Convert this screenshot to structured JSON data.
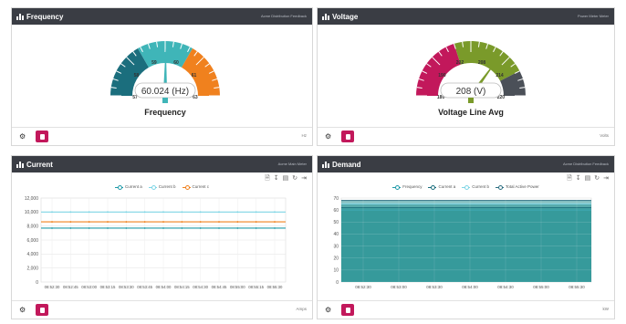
{
  "frequency_panel": {
    "title": "Frequency",
    "subtitle": "Acme Distribution Feedback",
    "gauge": {
      "value_text": "60.024 (Hz)",
      "label": "Frequency",
      "min": 57,
      "max": 63,
      "value": 60.024,
      "ticks": [
        "57",
        "58",
        "59",
        "60",
        "61",
        "63"
      ],
      "bands": [
        {
          "from": 57,
          "to": 59,
          "color": "#1b6e7d"
        },
        {
          "from": 59,
          "to": 61,
          "color": "#3fb5b8"
        },
        {
          "from": 61,
          "to": 63,
          "color": "#f0811e"
        }
      ]
    },
    "unit": "Hz"
  },
  "voltage_panel": {
    "title": "Voltage",
    "subtitle": "Power Meter Meter",
    "gauge": {
      "value_text": "208 (V)",
      "label": "Voltage Line Avg",
      "min": 180,
      "max": 220,
      "value": 208,
      "ticks": [
        "180",
        "190",
        "202",
        "208",
        "214",
        "220"
      ],
      "bands": [
        {
          "from": 180,
          "to": 196,
          "color": "#c2185b"
        },
        {
          "from": 196,
          "to": 214,
          "color": "#7a9a2a"
        },
        {
          "from": 214,
          "to": 220,
          "color": "#4b5058"
        }
      ]
    },
    "unit": "Volts"
  },
  "current_panel": {
    "title": "Current",
    "subtitle": "Acme Main Meter",
    "legend": [
      {
        "name": "Current a",
        "color": "#1f9aa8"
      },
      {
        "name": "Current b",
        "color": "#7ed6e6"
      },
      {
        "name": "Current c",
        "color": "#f0811e"
      }
    ],
    "unit": "Amps"
  },
  "demand_panel": {
    "title": "Demand",
    "subtitle": "Acme Distribution Feedback",
    "legend": [
      {
        "name": "Frequency",
        "color": "#1f9aa8"
      },
      {
        "name": "Current a",
        "color": "#1b6e7d"
      },
      {
        "name": "Current b",
        "color": "#7ed6e6"
      },
      {
        "name": "Total Active Power",
        "color": "#2c6e80"
      }
    ],
    "unit": "kW"
  },
  "tool_icons": [
    "document-icon",
    "download-icon",
    "bar-chart-icon",
    "refresh-icon",
    "export-icon"
  ],
  "chart_data": [
    {
      "type": "line",
      "title": "Current",
      "ylim": [
        0,
        12000
      ],
      "yticks": [
        "0",
        "2,000",
        "4,000",
        "6,000",
        "8,000",
        "10,000",
        "12,000"
      ],
      "categories": [
        "08:52:30",
        "08:52:45",
        "08:53:00",
        "08:53:15",
        "08:53:30",
        "08:53:45",
        "08:54:00",
        "08:54:15",
        "08:54:30",
        "08:54:45",
        "08:55:00",
        "08:55:15",
        "08:55:30"
      ],
      "series": [
        {
          "name": "Current a",
          "color": "#1f9aa8",
          "values": [
            7700,
            7700,
            7700,
            7700,
            7700,
            7700,
            7700,
            7700,
            7700,
            7700,
            7700,
            7700,
            7700
          ]
        },
        {
          "name": "Current b",
          "color": "#7ed6e6",
          "values": [
            10000,
            10000,
            10000,
            10000,
            10000,
            10000,
            10000,
            10000,
            10000,
            10000,
            10000,
            10000,
            10000
          ]
        },
        {
          "name": "Current c",
          "color": "#f0811e",
          "values": [
            8600,
            8600,
            8600,
            8600,
            8600,
            8600,
            8600,
            8600,
            8600,
            8600,
            8600,
            8600,
            8600
          ]
        }
      ],
      "grid": true
    },
    {
      "type": "area",
      "title": "Demand",
      "ylim": [
        0,
        70
      ],
      "yticks": [
        "0",
        "10",
        "20",
        "30",
        "40",
        "50",
        "60",
        "70"
      ],
      "categories": [
        "08:52:30",
        "08:53:00",
        "08:53:30",
        "08:54:00",
        "08:54:30",
        "08:55:00",
        "08:55:30"
      ],
      "series": [
        {
          "name": "Frequency",
          "color": "#1f9aa8",
          "values": [
            60,
            60,
            60,
            60,
            60,
            60,
            60
          ]
        },
        {
          "name": "Current a",
          "color": "#1b6e7d",
          "values": [
            62,
            62,
            62,
            62,
            62,
            62,
            62
          ]
        },
        {
          "name": "Current b",
          "color": "#7ed6e6",
          "values": [
            65,
            65,
            65,
            65,
            65,
            65,
            65
          ]
        },
        {
          "name": "Total Active Power",
          "color": "#2c6e80",
          "values": [
            68,
            68,
            68,
            68,
            68,
            68,
            68
          ]
        }
      ],
      "grid": true
    }
  ]
}
